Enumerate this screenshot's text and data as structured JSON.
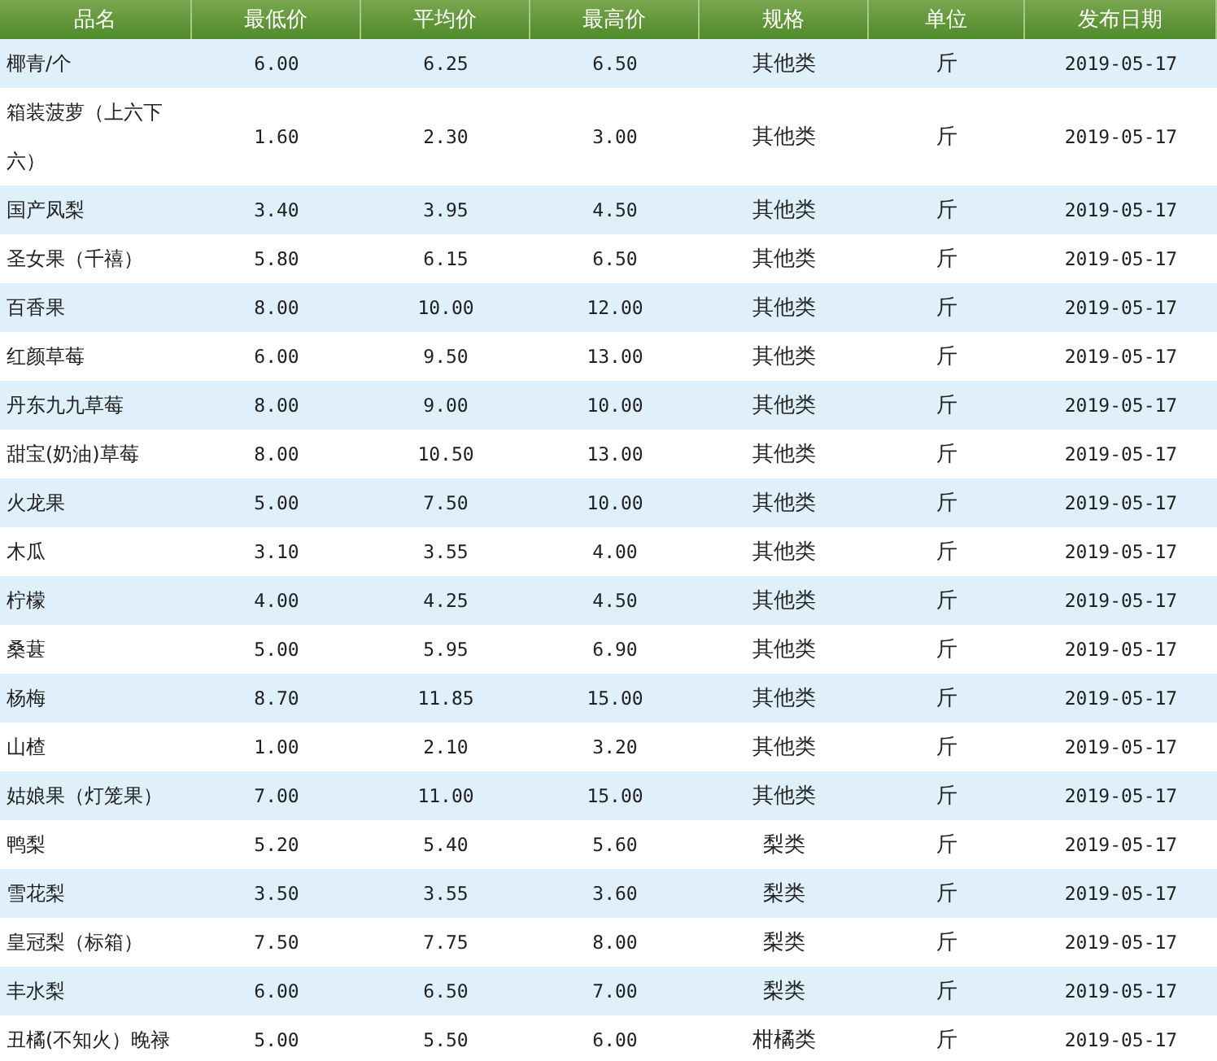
{
  "table": {
    "columns": [
      "品名",
      "最低价",
      "平均价",
      "最高价",
      "规格",
      "单位",
      "发布日期"
    ],
    "rows": [
      {
        "cells": [
          "椰青/个",
          "6.00",
          "6.25",
          "6.50",
          "其他类",
          "斤",
          "2019-05-17"
        ]
      },
      {
        "cells": [
          "箱装菠萝（上六下六）",
          "1.60",
          "2.30",
          "3.00",
          "其他类",
          "斤",
          "2019-05-17"
        ]
      },
      {
        "cells": [
          "国产凤梨",
          "3.40",
          "3.95",
          "4.50",
          "其他类",
          "斤",
          "2019-05-17"
        ]
      },
      {
        "cells": [
          "圣女果（千禧）",
          "5.80",
          "6.15",
          "6.50",
          "其他类",
          "斤",
          "2019-05-17"
        ]
      },
      {
        "cells": [
          "百香果",
          "8.00",
          "10.00",
          "12.00",
          "其他类",
          "斤",
          "2019-05-17"
        ]
      },
      {
        "cells": [
          "红颜草莓",
          "6.00",
          "9.50",
          "13.00",
          "其他类",
          "斤",
          "2019-05-17"
        ]
      },
      {
        "cells": [
          "丹东九九草莓",
          "8.00",
          "9.00",
          "10.00",
          "其他类",
          "斤",
          "2019-05-17"
        ]
      },
      {
        "cells": [
          "甜宝(奶油)草莓",
          "8.00",
          "10.50",
          "13.00",
          "其他类",
          "斤",
          "2019-05-17"
        ]
      },
      {
        "cells": [
          "火龙果",
          "5.00",
          "7.50",
          "10.00",
          "其他类",
          "斤",
          "2019-05-17"
        ]
      },
      {
        "cells": [
          "木瓜",
          "3.10",
          "3.55",
          "4.00",
          "其他类",
          "斤",
          "2019-05-17"
        ]
      },
      {
        "cells": [
          "柠檬",
          "4.00",
          "4.25",
          "4.50",
          "其他类",
          "斤",
          "2019-05-17"
        ]
      },
      {
        "cells": [
          "桑葚",
          "5.00",
          "5.95",
          "6.90",
          "其他类",
          "斤",
          "2019-05-17"
        ]
      },
      {
        "cells": [
          "杨梅",
          "8.70",
          "11.85",
          "15.00",
          "其他类",
          "斤",
          "2019-05-17"
        ]
      },
      {
        "cells": [
          "山楂",
          "1.00",
          "2.10",
          "3.20",
          "其他类",
          "斤",
          "2019-05-17"
        ]
      },
      {
        "cells": [
          "姑娘果（灯笼果）",
          "7.00",
          "11.00",
          "15.00",
          "其他类",
          "斤",
          "2019-05-17"
        ]
      },
      {
        "cells": [
          "鸭梨",
          "5.20",
          "5.40",
          "5.60",
          "梨类",
          "斤",
          "2019-05-17"
        ]
      },
      {
        "cells": [
          "雪花梨",
          "3.50",
          "3.55",
          "3.60",
          "梨类",
          "斤",
          "2019-05-17"
        ]
      },
      {
        "cells": [
          "皇冠梨（标箱）",
          "7.50",
          "7.75",
          "8.00",
          "梨类",
          "斤",
          "2019-05-17"
        ]
      },
      {
        "cells": [
          "丰水梨",
          "6.00",
          "6.50",
          "7.00",
          "梨类",
          "斤",
          "2019-05-17"
        ]
      },
      {
        "cells": [
          "丑橘(不知火）晚禄",
          "5.00",
          "5.50",
          "6.00",
          "柑橘类",
          "斤",
          "2019-05-17"
        ]
      }
    ]
  }
}
